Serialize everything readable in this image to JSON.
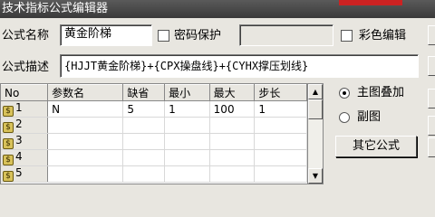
{
  "window": {
    "title": "技术指标公式编辑器"
  },
  "form": {
    "name_label": "公式名称",
    "name_value": "黄金阶梯",
    "password_label": "密码保护",
    "password_checked": false,
    "password_value": "",
    "color_edit_label": "彩色编辑",
    "color_edit_checked": false,
    "desc_label": "公式描述",
    "desc_value": "{HJJT黄金阶梯}+{CPX操盘线}+{CYHX撑压划线}"
  },
  "params": {
    "columns": [
      "No",
      "参数名",
      "缺省",
      "最小",
      "最大",
      "步长"
    ],
    "rows": [
      {
        "no": "1",
        "name": "N",
        "default": "5",
        "min": "1",
        "max": "100",
        "step": "1"
      },
      {
        "no": "2",
        "name": "",
        "default": "",
        "min": "",
        "max": "",
        "step": ""
      },
      {
        "no": "3",
        "name": "",
        "default": "",
        "min": "",
        "max": "",
        "step": ""
      },
      {
        "no": "4",
        "name": "",
        "default": "",
        "min": "",
        "max": "",
        "step": ""
      },
      {
        "no": "5",
        "name": "",
        "default": "",
        "min": "",
        "max": "",
        "step": ""
      }
    ]
  },
  "display": {
    "main_chart_label": "主图叠加",
    "main_chart_selected": true,
    "sub_chart_label": "副图",
    "sub_chart_selected": false
  },
  "buttons": {
    "other_formula": "其它公式"
  },
  "colors": {
    "title_bg": "#3f3f3f",
    "title_accent": "#cc2222",
    "row_icon": "#d8c25a",
    "window_bg": "#e8e6e0"
  }
}
